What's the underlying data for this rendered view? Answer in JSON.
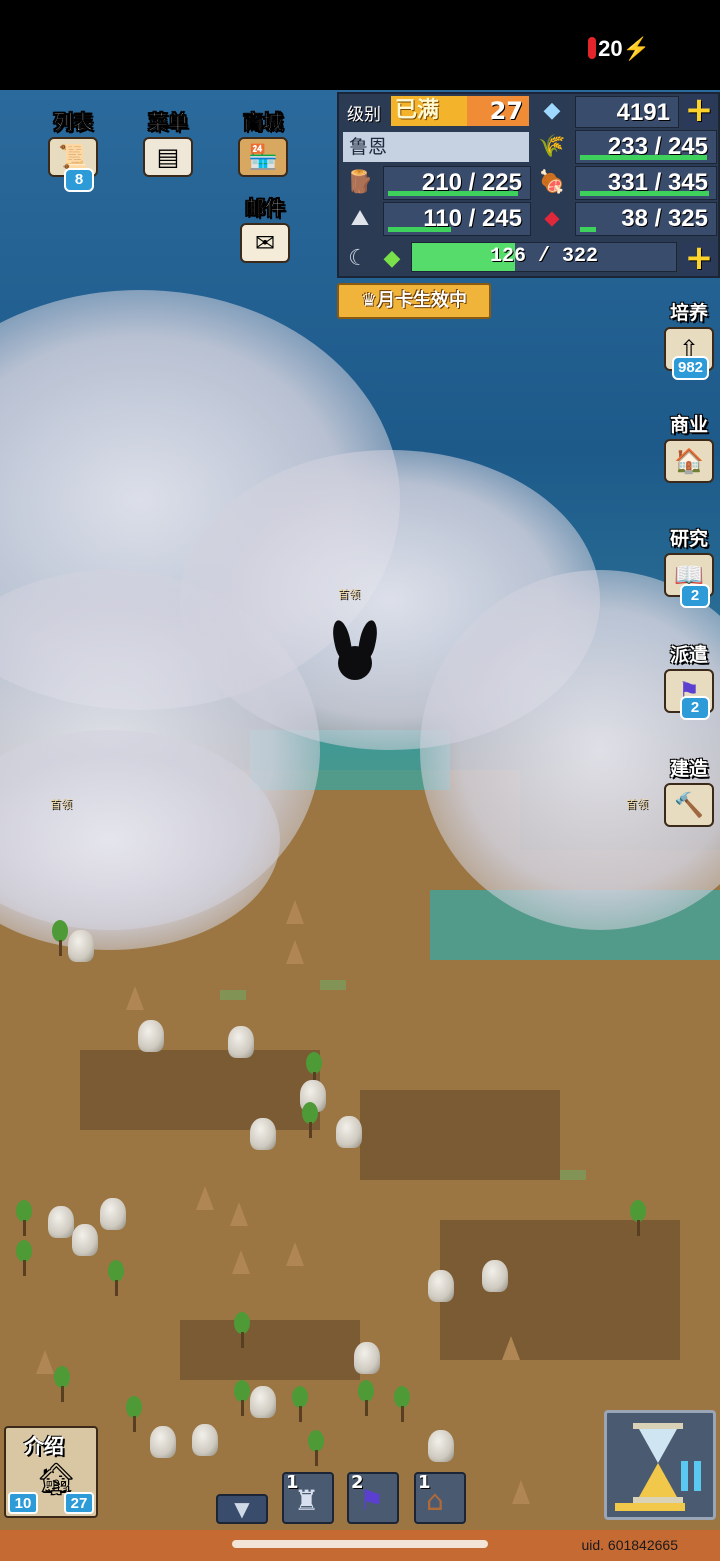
{
  "status_bar": {
    "battery": "20"
  },
  "top_menu": [
    {
      "label": "列表",
      "badge": "8"
    },
    {
      "label": "菜单"
    },
    {
      "label": "商城"
    },
    {
      "label": "邮件"
    }
  ],
  "resources": {
    "level_label": "级别",
    "level_status": "已满",
    "level": "27",
    "diamonds": "4191",
    "player_name": "鲁恩",
    "food": {
      "text": "233 / 245",
      "fraction": 0.95
    },
    "wood": {
      "text": "210 / 225",
      "fraction": 0.93
    },
    "meat": {
      "text": "331 / 345",
      "fraction": 0.96
    },
    "ore": {
      "text": "110 / 245",
      "fraction": 0.45
    },
    "gems": {
      "text": "38 / 325",
      "fraction": 0.12
    },
    "exp": {
      "text": "126 / 322",
      "fraction": 0.39
    }
  },
  "monthly_card": "月卡生效中",
  "side_menu": [
    {
      "label": "培养",
      "badge": "982"
    },
    {
      "label": "商业"
    },
    {
      "label": "研究",
      "badge": "2"
    },
    {
      "label": "派遣",
      "badge": "2"
    },
    {
      "label": "建造"
    }
  ],
  "map": {
    "boss_label": "首领"
  },
  "bottom": {
    "intro_label": "介绍",
    "intro_left": "10",
    "intro_right": "27",
    "queue": [
      "1",
      "2",
      "1"
    ],
    "uid": "uid. 601842665"
  },
  "colors": {
    "accent": "#ffd42a",
    "bar_fill": "#3ed15c",
    "bottom_bar": "#c66a34"
  },
  "icons": {
    "list": "scroll-icon",
    "menu": "signboard-icon",
    "shop": "shop-icon",
    "mail": "envelope-icon",
    "cultivate": "training-icon",
    "business": "house-icon",
    "research": "book-icon",
    "dispatch": "flag-icon",
    "build": "hammer-icon",
    "speed": "hourglass-icon"
  }
}
